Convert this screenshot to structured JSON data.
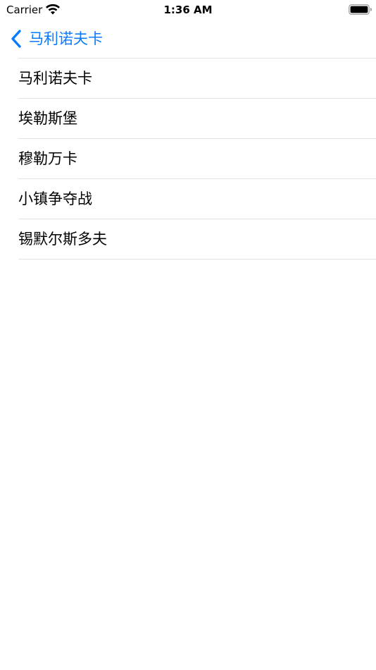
{
  "status_bar": {
    "carrier": "Carrier",
    "time": "1:36 AM"
  },
  "nav_bar": {
    "back_label": "马利诺夫卡",
    "accent_color": "#0a7aff"
  },
  "list": {
    "items": [
      {
        "label": "马利诺夫卡"
      },
      {
        "label": "埃勒斯堡"
      },
      {
        "label": "穆勒万卡"
      },
      {
        "label": "小镇争夺战"
      },
      {
        "label": "锡默尔斯多夫"
      }
    ]
  },
  "icons": {
    "wifi": "wifi-icon",
    "battery": "battery-icon",
    "back": "chevron-left-icon"
  }
}
